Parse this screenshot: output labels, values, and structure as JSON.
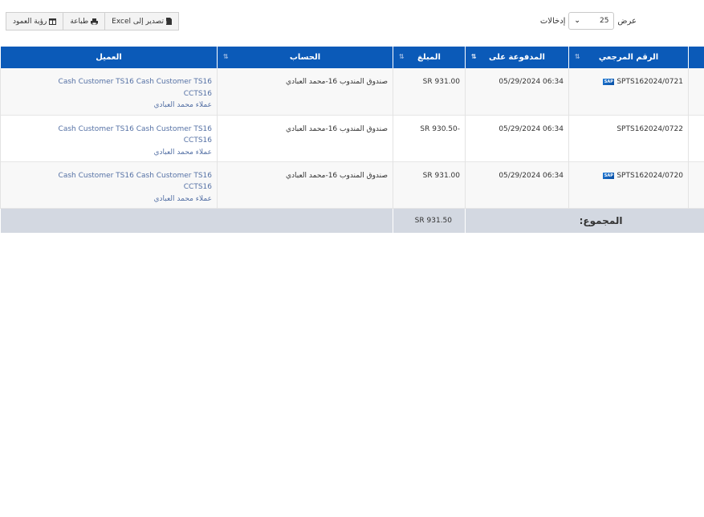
{
  "toolbar": {
    "column_visibility": "رؤية العمود",
    "print": "طباعة",
    "export_excel": "تصدير إلى Excel"
  },
  "length": {
    "show": "عرض",
    "value": "25",
    "entries": "إدخالات"
  },
  "table": {
    "headers": {
      "ref": "الرقم المرجعي",
      "paid_on": "المدفوعة على",
      "amount": "المبلغ",
      "account": "الحساب",
      "customer": "العميل"
    },
    "rows": [
      {
        "ref": "SPTS162024/0721",
        "has_sap": true,
        "paid_on": "05/29/2024 06:34",
        "amount": "SR 931.00",
        "account": "صندوق المندوب 16-محمد العبادي",
        "customer_line1": "Cash Customer TS16 Cash Customer TS16",
        "customer_line2": "CCTS16",
        "customer_line3": "عملاء محمد العبادي"
      },
      {
        "ref": "SPTS162024/0722",
        "has_sap": false,
        "paid_on": "05/29/2024 06:34",
        "amount": "SR 930.50-",
        "account": "صندوق المندوب 16-محمد العبادي",
        "customer_line1": "Cash Customer TS16 Cash Customer TS16",
        "customer_line2": "CCTS16",
        "customer_line3": "عملاء محمد العبادي"
      },
      {
        "ref": "SPTS162024/0720",
        "has_sap": true,
        "paid_on": "05/29/2024 06:34",
        "amount": "SR 931.00",
        "account": "صندوق المندوب 16-محمد العبادي",
        "customer_line1": "Cash Customer TS16 Cash Customer TS16",
        "customer_line2": "CCTS16",
        "customer_line3": "عملاء محمد العبادي"
      }
    ],
    "footer": {
      "label": "المجموع:",
      "total": "SR 931.50"
    }
  }
}
